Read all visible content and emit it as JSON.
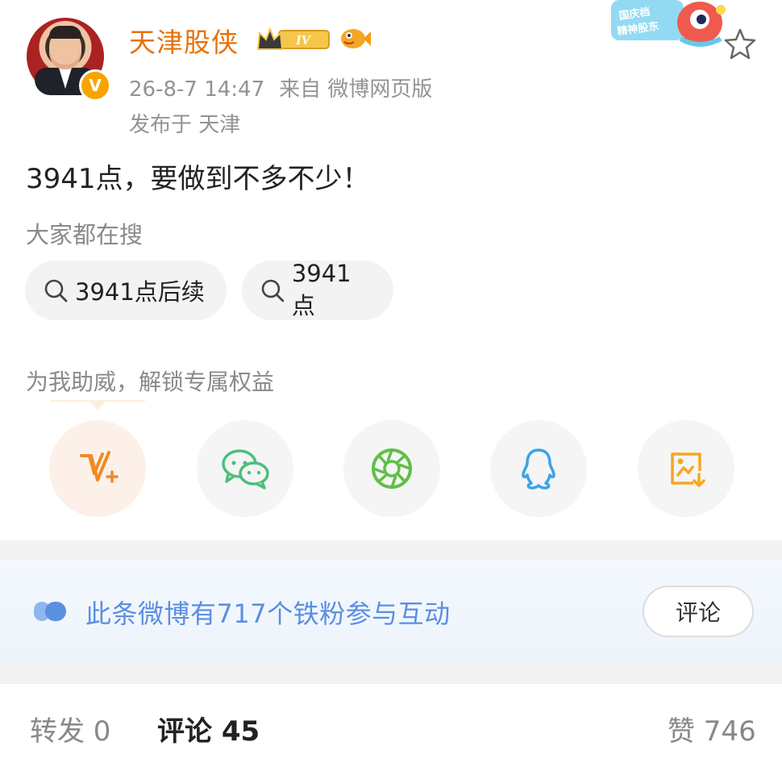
{
  "post": {
    "username": "天津股侠",
    "level_badge": "IV",
    "verified_mark": "V",
    "time": "26-8-7 14:47",
    "source": "来自 微博网页版",
    "location": "发布于 天津",
    "holiday_badge_text": [
      "国庆档",
      "精神股东"
    ],
    "text": "3941点，要做到不多不少！"
  },
  "search": {
    "heading": "大家都在搜",
    "chips": [
      "3941点后续",
      "3941点"
    ]
  },
  "support": {
    "text": "为我助威，解锁专属权益",
    "share_icons": [
      "v-plus-icon",
      "wechat-icon",
      "moments-icon",
      "qq-icon",
      "save-image-icon"
    ]
  },
  "fans": {
    "text": "此条微博有717个铁粉参与互动",
    "button": "评论"
  },
  "tabs": {
    "repost": "转发 0",
    "comment": "评论 45",
    "like": "赞 746"
  },
  "colors": {
    "username": "#e8710a",
    "accent_orange": "#f7a400",
    "fan_blue": "#5b8fe0",
    "wechat_green": "#4cbf7a",
    "qq_blue": "#3aa3e8"
  }
}
